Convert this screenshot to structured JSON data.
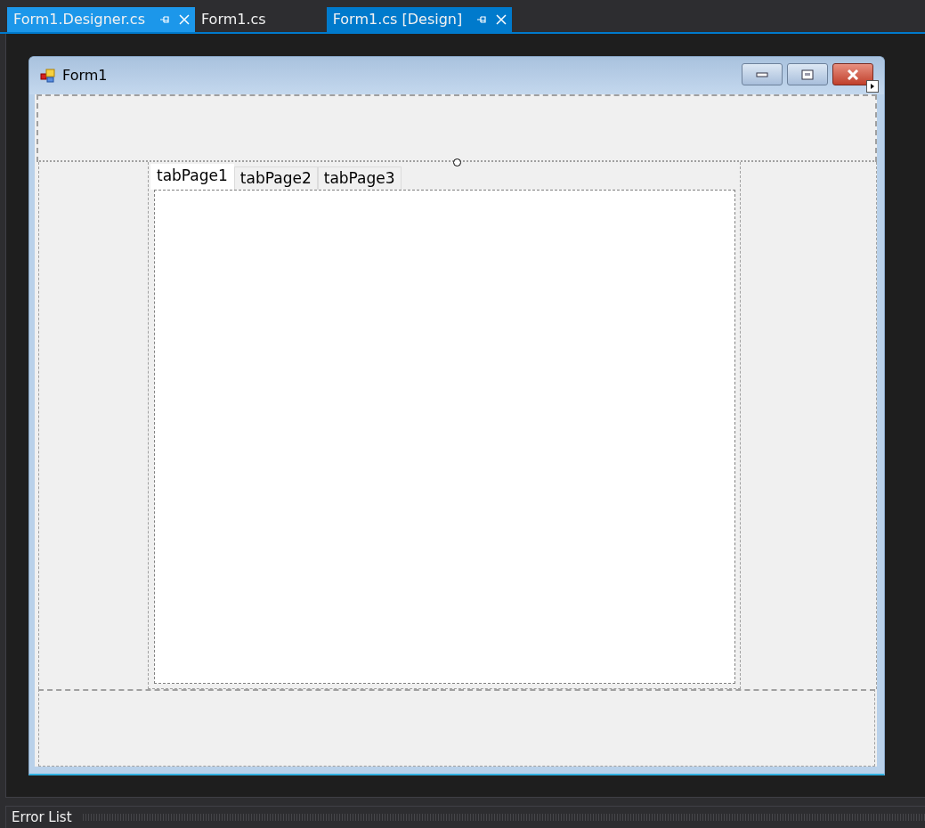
{
  "document_tabs": [
    {
      "label": "Form1.Designer.cs",
      "selected": false,
      "highlighted": true,
      "closable": true
    },
    {
      "label": "Form1.cs",
      "selected": false,
      "highlighted": false,
      "closable": false
    },
    {
      "label": "Form1.cs [Design]",
      "selected": true,
      "highlighted": false,
      "closable": true
    }
  ],
  "form": {
    "title": "Form1",
    "tab_control": {
      "tabs": [
        {
          "label": "tabPage1",
          "selected": true
        },
        {
          "label": "tabPage2",
          "selected": false
        },
        {
          "label": "tabPage3",
          "selected": false
        }
      ]
    }
  },
  "bottom_panel": {
    "title": "Error List"
  }
}
